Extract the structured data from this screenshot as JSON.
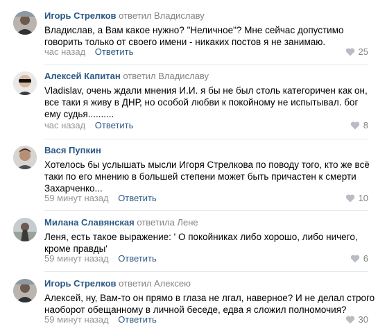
{
  "comments": [
    {
      "author": "Игорь Стрелков",
      "replied": "ответил Владиславу",
      "lines": [
        "Владислав, а Вам какое нужно? \"Неличное\"? Мне сейчас допустимо",
        "говорить только от своего имени - никаких постов я не занимаю."
      ],
      "time": "час назад",
      "reply_label": "Ответить",
      "likes": "25"
    },
    {
      "author": "Алексей Капитан",
      "replied": "ответил Владиславу",
      "lines": [
        "Vladislav, очень ждали мнения И.И. я бы не был столь категоричен как он,",
        "все таки я живу в ДНР, но особой любви к покойному не испытывал. бог",
        "ему судья.........."
      ],
      "time": "час назад",
      "reply_label": "Ответить",
      "likes": "8"
    },
    {
      "author": "Вася Пупкин",
      "replied": "",
      "lines": [
        "Хотелось бы услышать мысли Игоря Стрелкова по поводу того, кто же всё",
        "таки по его мнению в большей степени может быть причастен к смерти",
        "Захарченко..."
      ],
      "time": "59 минут назад",
      "reply_label": "Ответить",
      "likes": "10"
    },
    {
      "author": "Милана Славянская",
      "replied": "ответила Лене",
      "lines": [
        "Леня, есть такое выражение: ' О покойниках либо хорошо, либо ничего,",
        "кроме правды'"
      ],
      "time": "59 минут назад",
      "reply_label": "Ответить",
      "likes": "6"
    },
    {
      "author": "Игорь Стрелков",
      "replied": "ответил Алексею",
      "lines": [
        "Алексей, ну, Вам-то он прямо в глаза не лгал, наверное? И не делал строго",
        "наоборот обещанному в личной беседе, едва я сложил полномочия?"
      ],
      "time": "59 минут назад",
      "reply_label": "Ответить",
      "likes": "30"
    }
  ],
  "colors": {
    "author": "#2a5885",
    "meta": "#939393",
    "divider": "#e7e8ec"
  },
  "icons": {
    "avatar": "user-avatar-photo",
    "like": "heart-icon"
  }
}
